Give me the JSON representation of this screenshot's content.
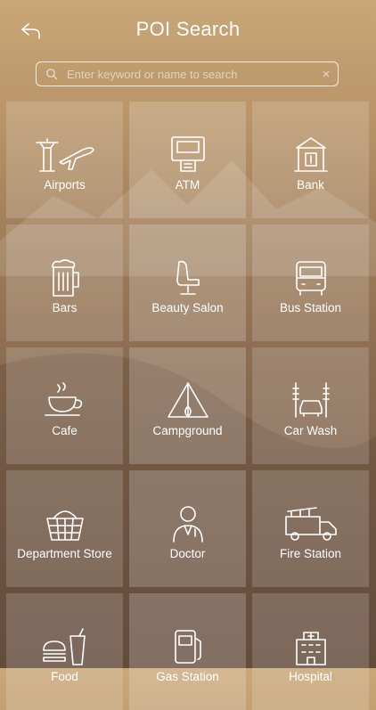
{
  "header": {
    "title": "POI Search",
    "back_icon": "back-arrow-icon"
  },
  "search": {
    "placeholder": "Enter keyword or name to search",
    "value": "",
    "clear_label": "×"
  },
  "categories": [
    {
      "label": "Airports",
      "icon": "airport-icon"
    },
    {
      "label": "ATM",
      "icon": "atm-icon"
    },
    {
      "label": "Bank",
      "icon": "bank-icon"
    },
    {
      "label": "Bars",
      "icon": "beer-mug-icon"
    },
    {
      "label": "Beauty Salon",
      "icon": "salon-chair-icon"
    },
    {
      "label": "Bus Station",
      "icon": "bus-icon"
    },
    {
      "label": "Cafe",
      "icon": "coffee-cup-icon"
    },
    {
      "label": "Campground",
      "icon": "tent-icon"
    },
    {
      "label": "Car Wash",
      "icon": "car-wash-icon"
    },
    {
      "label": "Department Store",
      "icon": "shopping-basket-icon"
    },
    {
      "label": "Doctor",
      "icon": "doctor-icon"
    },
    {
      "label": "Fire Station",
      "icon": "fire-truck-icon"
    },
    {
      "label": "Food",
      "icon": "burger-drink-icon"
    },
    {
      "label": "Gas Station",
      "icon": "fuel-pump-icon"
    },
    {
      "label": "Hospital",
      "icon": "hospital-icon"
    }
  ]
}
